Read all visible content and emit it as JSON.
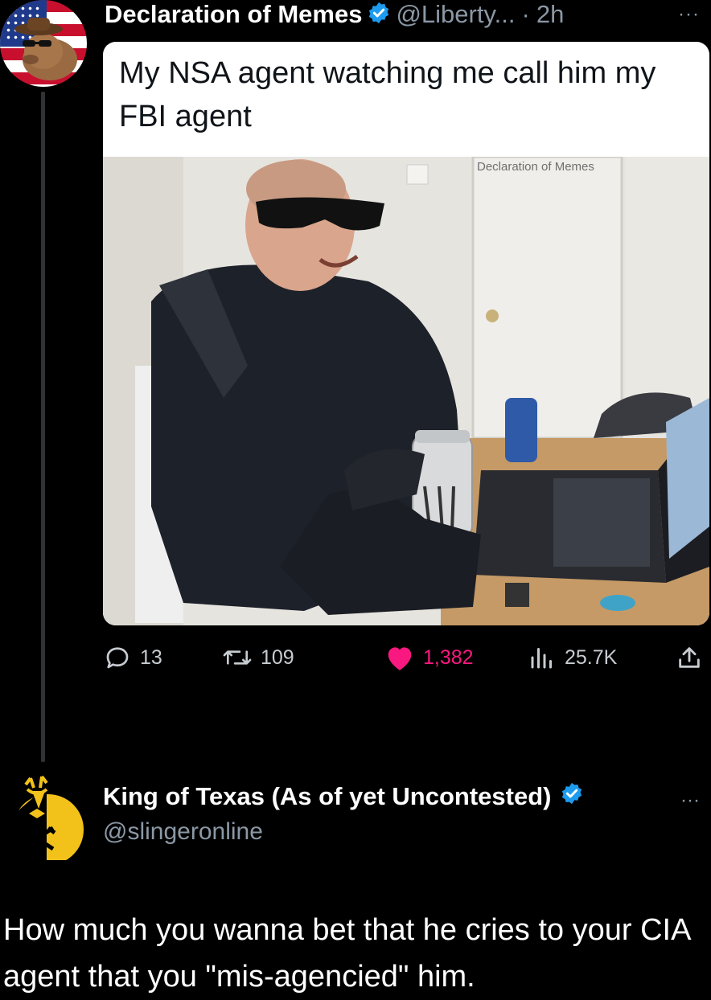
{
  "tweet": {
    "author_name": "Declaration of Memes",
    "author_handle": "@Liberty...",
    "separator": "·",
    "time": "2h",
    "more_label": "···",
    "meme_text": "My NSA agent watching me call him my FBI agent",
    "watermark": "Declaration of Memes",
    "stats": {
      "replies": "13",
      "retweets": "109",
      "likes": "1,382",
      "views": "25.7K"
    }
  },
  "reply": {
    "author_name": "King of Texas (As of yet Uncontested)",
    "author_handle": "@slingeronline",
    "more_label": "···",
    "text": "How much you wanna bet that he cries to your CIA agent that you \"mis-agencied\" him."
  },
  "colors": {
    "background": "#000000",
    "verified": "#1d9bf0",
    "like": "#f91880",
    "secondary_text": "#8b98a5",
    "reply_avatar": "#f2c21b"
  },
  "icons": [
    "reply-icon",
    "retweet-icon",
    "heart-icon",
    "views-icon",
    "share-icon",
    "verified-icon",
    "more-icon"
  ]
}
